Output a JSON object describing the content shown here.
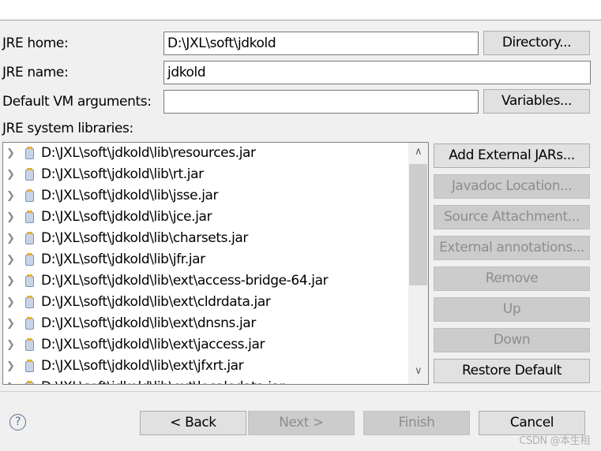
{
  "form": {
    "jre_home_label": "JRE home:",
    "jre_home_value": "D:\\JXL\\soft\\jdkold",
    "directory_button": "Directory...",
    "jre_name_label": "JRE name:",
    "jre_name_value": "jdkold",
    "vm_args_label": "Default VM arguments:",
    "vm_args_value": "",
    "variables_button": "Variables...",
    "libraries_label": "JRE system libraries:"
  },
  "libraries": [
    "D:\\JXL\\soft\\jdkold\\lib\\resources.jar",
    "D:\\JXL\\soft\\jdkold\\lib\\rt.jar",
    "D:\\JXL\\soft\\jdkold\\lib\\jsse.jar",
    "D:\\JXL\\soft\\jdkold\\lib\\jce.jar",
    "D:\\JXL\\soft\\jdkold\\lib\\charsets.jar",
    "D:\\JXL\\soft\\jdkold\\lib\\jfr.jar",
    "D:\\JXL\\soft\\jdkold\\lib\\ext\\access-bridge-64.jar",
    "D:\\JXL\\soft\\jdkold\\lib\\ext\\cldrdata.jar",
    "D:\\JXL\\soft\\jdkold\\lib\\ext\\dnsns.jar",
    "D:\\JXL\\soft\\jdkold\\lib\\ext\\jaccess.jar",
    "D:\\JXL\\soft\\jdkold\\lib\\ext\\jfxrt.jar",
    "D:\\JXL\\soft\\jdkold\\lib\\ext\\localedata.jar"
  ],
  "side_buttons": [
    {
      "label": "Add External JARs...",
      "enabled": true
    },
    {
      "label": "Javadoc Location...",
      "enabled": false
    },
    {
      "label": "Source Attachment...",
      "enabled": false
    },
    {
      "label": "External annotations...",
      "enabled": false
    },
    {
      "label": "Remove",
      "enabled": false
    },
    {
      "label": "Up",
      "enabled": false
    },
    {
      "label": "Down",
      "enabled": false
    },
    {
      "label": "Restore Default",
      "enabled": true
    }
  ],
  "footer": {
    "back": "< Back",
    "next": "Next >",
    "finish": "Finish",
    "cancel": "Cancel",
    "help_icon": "question-mark",
    "watermark": "CSDN @本生相"
  }
}
